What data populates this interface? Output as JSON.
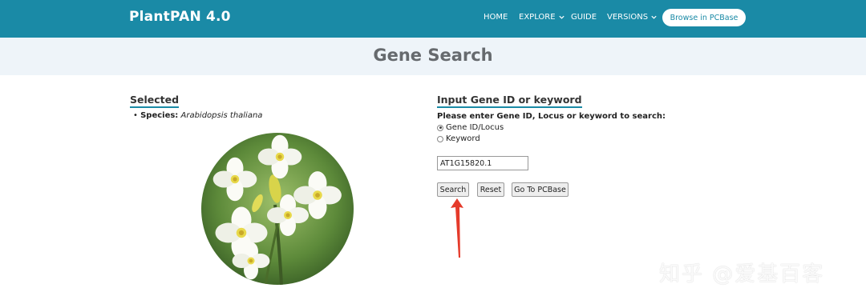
{
  "navbar": {
    "brand": "PlantPAN 4.0",
    "items": [
      {
        "label": "HOME",
        "dropdown": false
      },
      {
        "label": "EXPLORE",
        "dropdown": true
      },
      {
        "label": "GUIDE",
        "dropdown": false
      },
      {
        "label": "VERSIONS",
        "dropdown": true
      }
    ],
    "cta_label": "Browse in PCBase"
  },
  "page": {
    "title": "Gene Search"
  },
  "selected": {
    "heading": "Selected",
    "species_label": "Species:",
    "species_value": "Arabidopsis thaliana",
    "image_icon": "arabidopsis-flower-photo"
  },
  "search": {
    "heading": "Input Gene ID or keyword",
    "prompt": "Please enter Gene ID, Locus or keyword to search:",
    "options": [
      {
        "label": "Gene ID/Locus",
        "checked": true
      },
      {
        "label": "Keyword",
        "checked": false
      }
    ],
    "input_value": "AT1G15820.1",
    "buttons": {
      "search": "Search",
      "reset": "Reset",
      "pcbase": "Go To PCBase"
    }
  },
  "annotation": {
    "arrow_color": "#e53a2a"
  },
  "watermark": "知乎 @爱基百客",
  "colors": {
    "navbar": "#1a8aa6",
    "banner": "#eef4f9",
    "accent_underline": "#1a8aa6"
  }
}
